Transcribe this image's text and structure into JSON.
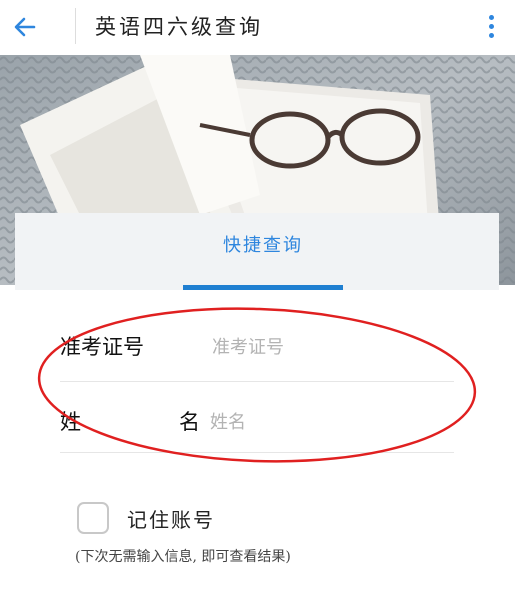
{
  "header": {
    "title": "英语四六级查询",
    "back_icon": "arrow-left-icon",
    "menu_icon": "more-vertical-icon",
    "accent_color": "#2e86de"
  },
  "hero": {
    "image": "book-and-glasses-photo"
  },
  "form": {
    "tab_label": "快捷查询",
    "exam_id": {
      "label": "准考证号",
      "placeholder": "准考证号",
      "value": ""
    },
    "name": {
      "label_first": "姓",
      "label_last": "名",
      "placeholder": "姓名",
      "value": ""
    },
    "remember_label": "记住账号",
    "remember_checked": false,
    "hint": "(下次无需输入信息, 即可查看结果)"
  },
  "annotation": {
    "color": "#e02020",
    "shape": "ellipse"
  }
}
